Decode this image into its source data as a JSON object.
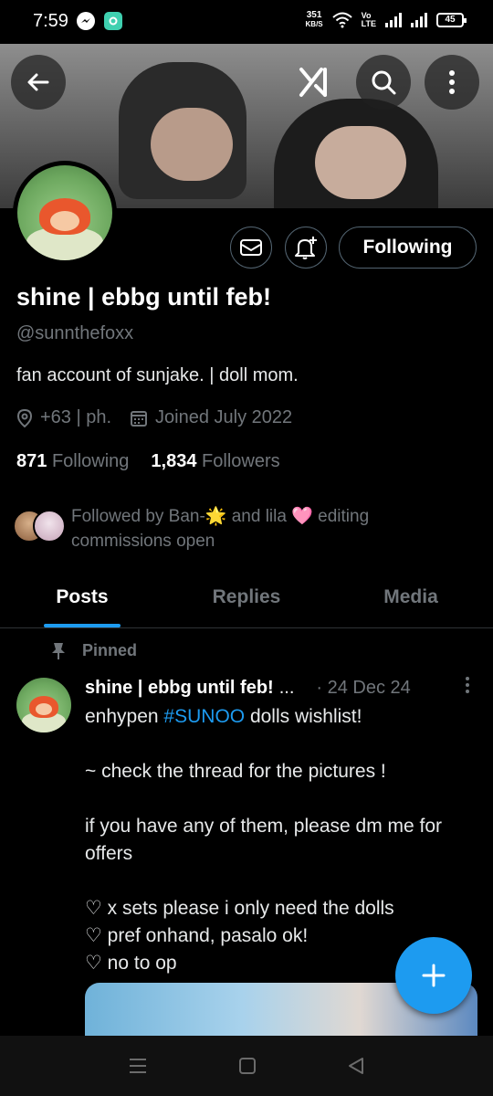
{
  "status_bar": {
    "time": "7:59",
    "speed_value": "351",
    "speed_unit": "KB/S",
    "network_label_top": "Vo",
    "network_label_bottom": "LTE",
    "battery": "45"
  },
  "profile": {
    "display_name": "shine | ebbg until feb!",
    "handle": "@sunnthefoxx",
    "bio": "fan account of sunjake. | doll mom.",
    "location": "+63 | ph.",
    "joined": "Joined July 2022",
    "following_count": "871",
    "following_label": "Following",
    "followers_count": "1,834",
    "followers_label": "Followers",
    "followed_by_text": "Followed by Ban-🌟 and lila 🩷 editing commissions open",
    "follow_button_label": "Following"
  },
  "tabs": [
    {
      "label": "Posts",
      "active": true
    },
    {
      "label": "Replies",
      "active": false
    },
    {
      "label": "Media",
      "active": false
    }
  ],
  "pinned_post": {
    "pinned_label": "Pinned",
    "author": "shine | ebbg until feb!",
    "ellipsis": "...",
    "date": "· 24 Dec 24",
    "body_prefix": "enhypen ",
    "hashtag": "#SUNOO",
    "body_suffix": " dolls wishlist!",
    "lines": [
      "",
      "~ check the thread for the pictures !",
      "",
      "if you have any of them, please dm me for offers",
      "",
      "♡ x sets please i only need the dolls",
      "♡ pref onhand, pasalo ok!",
      "♡ no to op"
    ]
  },
  "colors": {
    "accent": "#1d9bf0",
    "background": "#000000",
    "secondary_text": "#71767b",
    "border": "#2f3336"
  },
  "icons": {
    "back": "arrow-left-icon",
    "grok": "grok-icon",
    "search": "search-icon",
    "more": "more-vertical-icon",
    "message": "mail-icon",
    "notify": "bell-plus-icon",
    "location": "location-pin-icon",
    "calendar": "calendar-icon",
    "pin": "pin-icon",
    "compose": "plus-icon"
  }
}
